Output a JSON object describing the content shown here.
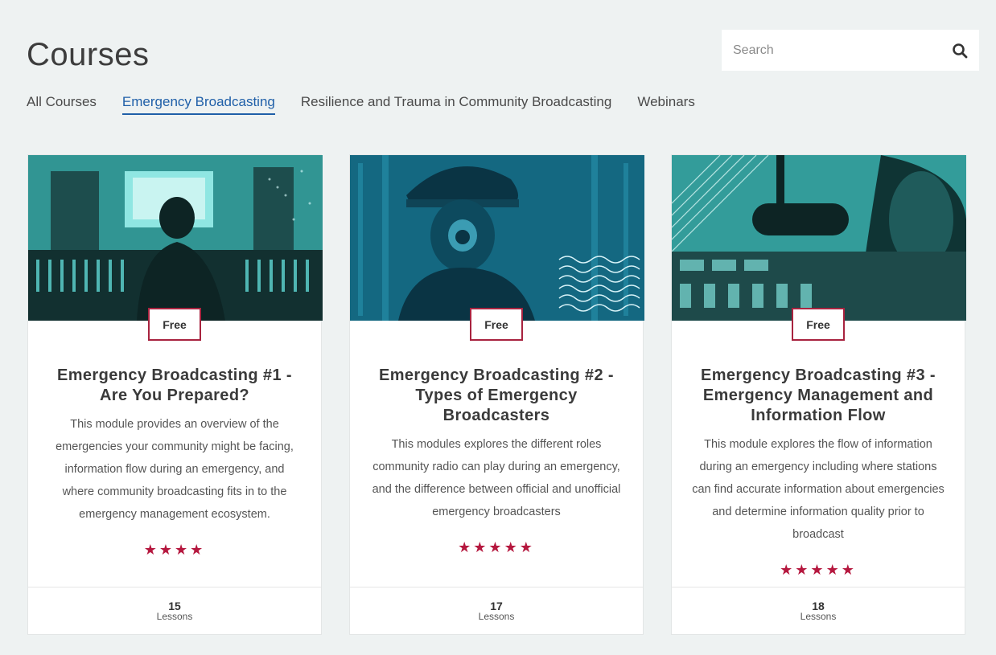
{
  "page": {
    "title": "Courses"
  },
  "search": {
    "placeholder": "Search"
  },
  "tabs": [
    {
      "label": "All Courses",
      "active": false
    },
    {
      "label": "Emergency Broadcasting",
      "active": true
    },
    {
      "label": "Resilience and Trauma in Community Broadcasting",
      "active": false
    },
    {
      "label": "Webinars",
      "active": false
    }
  ],
  "courses": [
    {
      "badge": "Free",
      "title": "Emergency Broadcasting #1 - Are You Prepared?",
      "description": "This module provides an overview of the emergencies your community might be facing, information flow during an emergency, and where community broadcasting fits in to the emergency management ecosystem.",
      "rating": 4,
      "stars": "★★★★",
      "lessons_count": "15",
      "lessons_label": "Lessons"
    },
    {
      "badge": "Free",
      "title": "Emergency Broadcasting #2 - Types of Emergency Broadcasters",
      "description": "This modules explores the different roles community radio can play during an emergency, and the difference between official and unofficial emergency broadcasters",
      "rating": 5,
      "stars": "★★★★★",
      "lessons_count": "17",
      "lessons_label": "Lessons"
    },
    {
      "badge": "Free",
      "title": "Emergency Broadcasting #3 - Emergency Management and Information Flow",
      "description": "This module explores the flow of information during an emergency including where stations can find accurate information about emergencies and determine information quality prior to broadcast",
      "rating": 5,
      "stars": "★★★★★",
      "lessons_count": "18",
      "lessons_label": "Lessons"
    }
  ],
  "colors": {
    "accent": "#1f5fa8",
    "badge_border": "#a8233f",
    "star": "#b5173e",
    "image_tint_1": "#3fc4c4",
    "image_tint_2": "#1a7c96"
  }
}
